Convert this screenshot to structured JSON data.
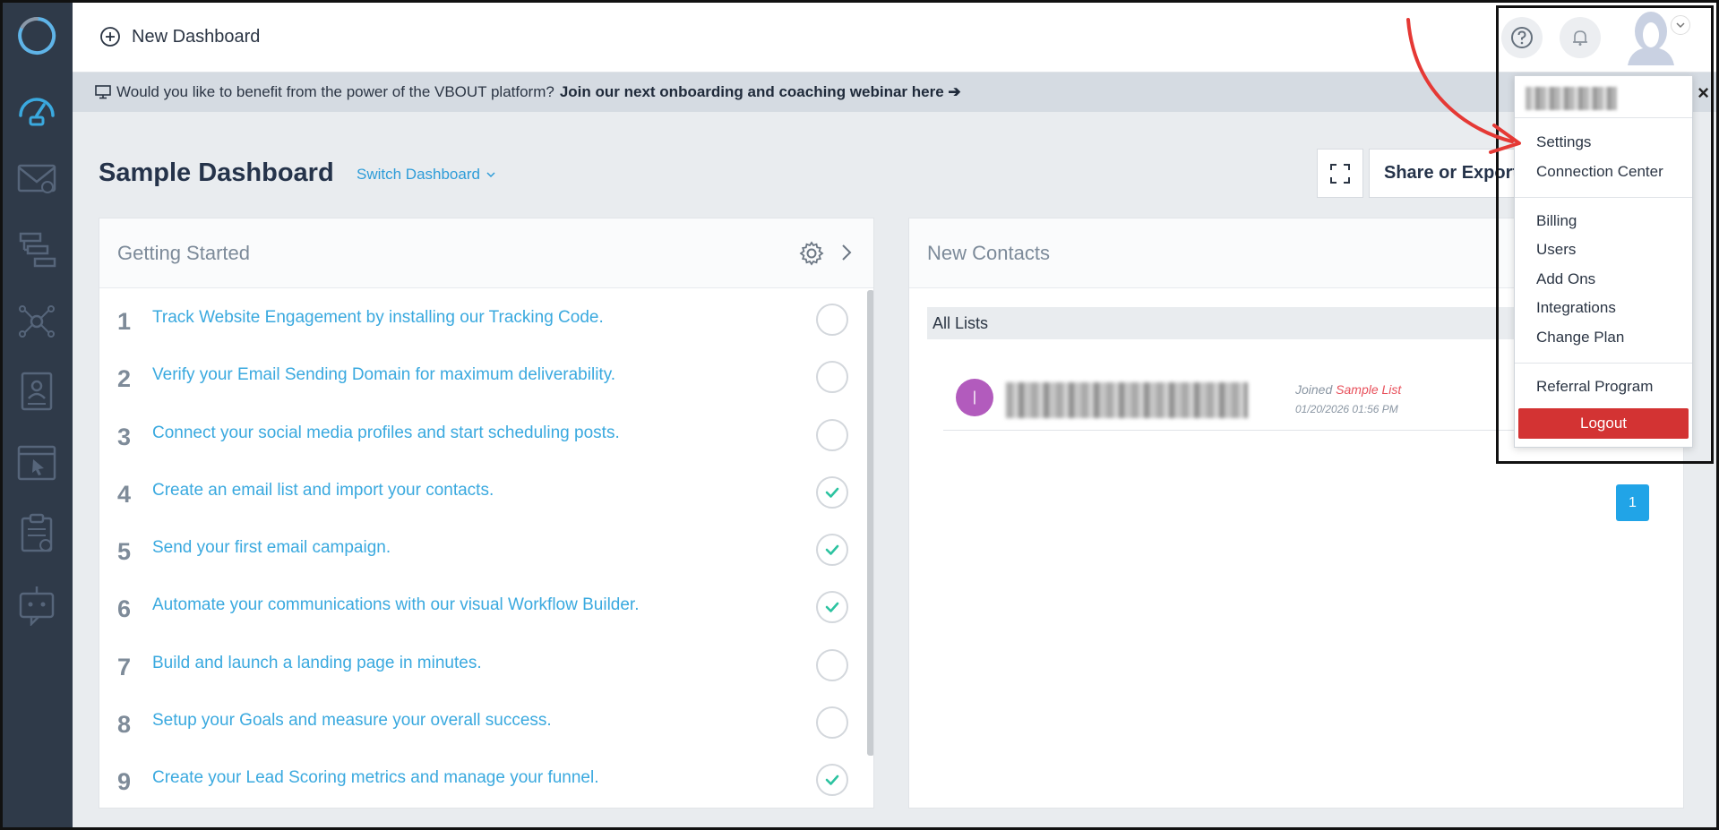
{
  "topbar": {
    "new_dashboard_label": "New Dashboard"
  },
  "banner": {
    "text": "Would you like to benefit from the power of the VBOUT platform?",
    "link_text": "Join our next onboarding and coaching webinar here ➔",
    "close": "×"
  },
  "page": {
    "title": "Sample Dashboard",
    "switch_label": "Switch Dashboard",
    "share_label": "Share or Export"
  },
  "getting_started": {
    "title": "Getting Started",
    "items": [
      {
        "num": "1",
        "text": "Track Website Engagement by installing our Tracking Code.",
        "done": false
      },
      {
        "num": "2",
        "text": "Verify your Email Sending Domain for maximum deliverability.",
        "done": false
      },
      {
        "num": "3",
        "text": "Connect your social media profiles and start scheduling posts.",
        "done": false
      },
      {
        "num": "4",
        "text": "Create an email list and import your contacts.",
        "done": true
      },
      {
        "num": "5",
        "text": "Send your first email campaign.",
        "done": true
      },
      {
        "num": "6",
        "text": "Automate your communications with our visual Workflow Builder.",
        "done": true
      },
      {
        "num": "7",
        "text": "Build and launch a landing page in minutes.",
        "done": false
      },
      {
        "num": "8",
        "text": "Setup your Goals and measure your overall success.",
        "done": false
      },
      {
        "num": "9",
        "text": "Create your Lead Scoring metrics and manage your funnel.",
        "done": true
      }
    ]
  },
  "new_contacts": {
    "title": "New Contacts",
    "filter": "All Lists",
    "contact": {
      "initial": "|",
      "joined_prefix": "Joined",
      "list_name": "Sample List",
      "date": "01/20/2026 01:56 PM"
    },
    "page": "1"
  },
  "dropdown": {
    "group1": [
      "Settings",
      "Connection Center"
    ],
    "group2": [
      "Billing",
      "Users",
      "Add Ons",
      "Integrations",
      "Change Plan"
    ],
    "group3": [
      "Referral Program"
    ],
    "logout": "Logout"
  },
  "colors": {
    "sidebar": "#2f3a49",
    "accent": "#2e9cd8",
    "check": "#2cc3a0",
    "logout": "#d33333",
    "annotation_arrow": "#e53935"
  }
}
